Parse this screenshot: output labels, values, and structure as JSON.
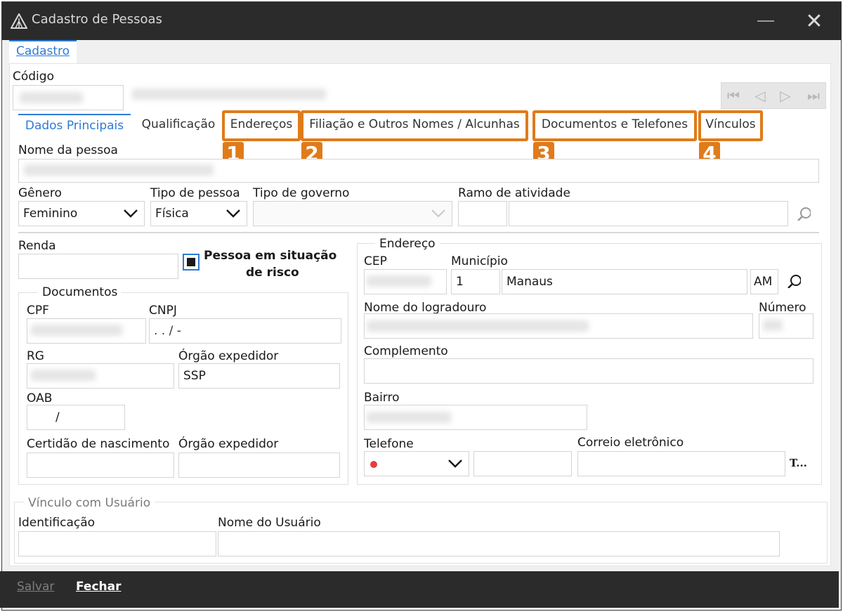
{
  "window": {
    "title": "Cadastro de Pessoas",
    "close_glyph": "✕"
  },
  "top_tab": {
    "label": "Cadastro"
  },
  "codigo": {
    "label": "Código"
  },
  "tabs": [
    {
      "label": "Dados Principais",
      "active": true
    },
    {
      "label": "Qualificação"
    },
    {
      "label": "Endereços"
    },
    {
      "label": "Filiação e Outros Nomes / Alcunhas"
    },
    {
      "label": "Documentos e Telefones"
    },
    {
      "label": "Vínculos"
    }
  ],
  "badges": [
    "1",
    "2",
    "3",
    "4"
  ],
  "nav": {
    "first": "⏮",
    "prev": "◁",
    "next": "▷",
    "last": "⏭"
  },
  "nome_pessoa": {
    "label": "Nome da pessoa"
  },
  "genero": {
    "label": "Gênero",
    "value": "Feminino"
  },
  "tipo_pessoa": {
    "label": "Tipo de pessoa",
    "value": "Física"
  },
  "tipo_governo": {
    "label": "Tipo de governo",
    "value": ""
  },
  "ramo_atividade": {
    "label": "Ramo de atividade"
  },
  "renda": {
    "label": "Renda"
  },
  "risco": {
    "line1": "Pessoa em situação",
    "line2": "de risco",
    "checked": true
  },
  "documentos": {
    "title": "Documentos",
    "cpf_label": "CPF",
    "cnpj_label": "CNPJ",
    "cnpj_mask": " .  .  /    -",
    "rg_label": "RG",
    "orgao_label": "Órgão expedidor",
    "orgao_value": "SSP",
    "oab_label": "OAB",
    "oab_value": "/",
    "certidao_label": "Certidão de nascimento",
    "orgao2_label": "Órgão expedidor"
  },
  "endereco": {
    "title": "Endereço",
    "cep_label": "CEP",
    "municipio_label": "Município",
    "municipio_code": "1",
    "municipio_name": "Manaus",
    "uf": "AM",
    "logradouro_label": "Nome do logradouro",
    "numero_label": "Número",
    "complemento_label": "Complemento",
    "bairro_label": "Bairro",
    "telefone_label": "Telefone",
    "email_label": "Correio eletrônico",
    "truncated": "T..."
  },
  "vinculo": {
    "title": "Vínculo com Usuário",
    "identificacao_label": "Identificação",
    "nome_usuario_label": "Nome do Usuário"
  },
  "footer": {
    "salvar": "Salvar",
    "fechar": "Fechar"
  },
  "colors": {
    "accent": "#2d7bd6",
    "highlight": "#e07b1a",
    "titlebar": "#2b2b2b"
  }
}
